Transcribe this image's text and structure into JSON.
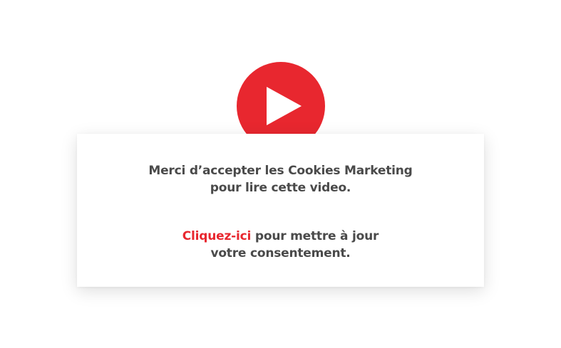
{
  "play_button": {
    "icon": "play-icon",
    "color": "#e8272f"
  },
  "consent": {
    "line1": "Merci d’accepter les Cookies Marketing",
    "line2": "pour lire cette video.",
    "link_label": "Cliquez-ici",
    "line3_suffix": " pour mettre à jour",
    "line4": "votre consentement.",
    "text_color": "#4a4a4a",
    "link_color": "#e8272f"
  }
}
